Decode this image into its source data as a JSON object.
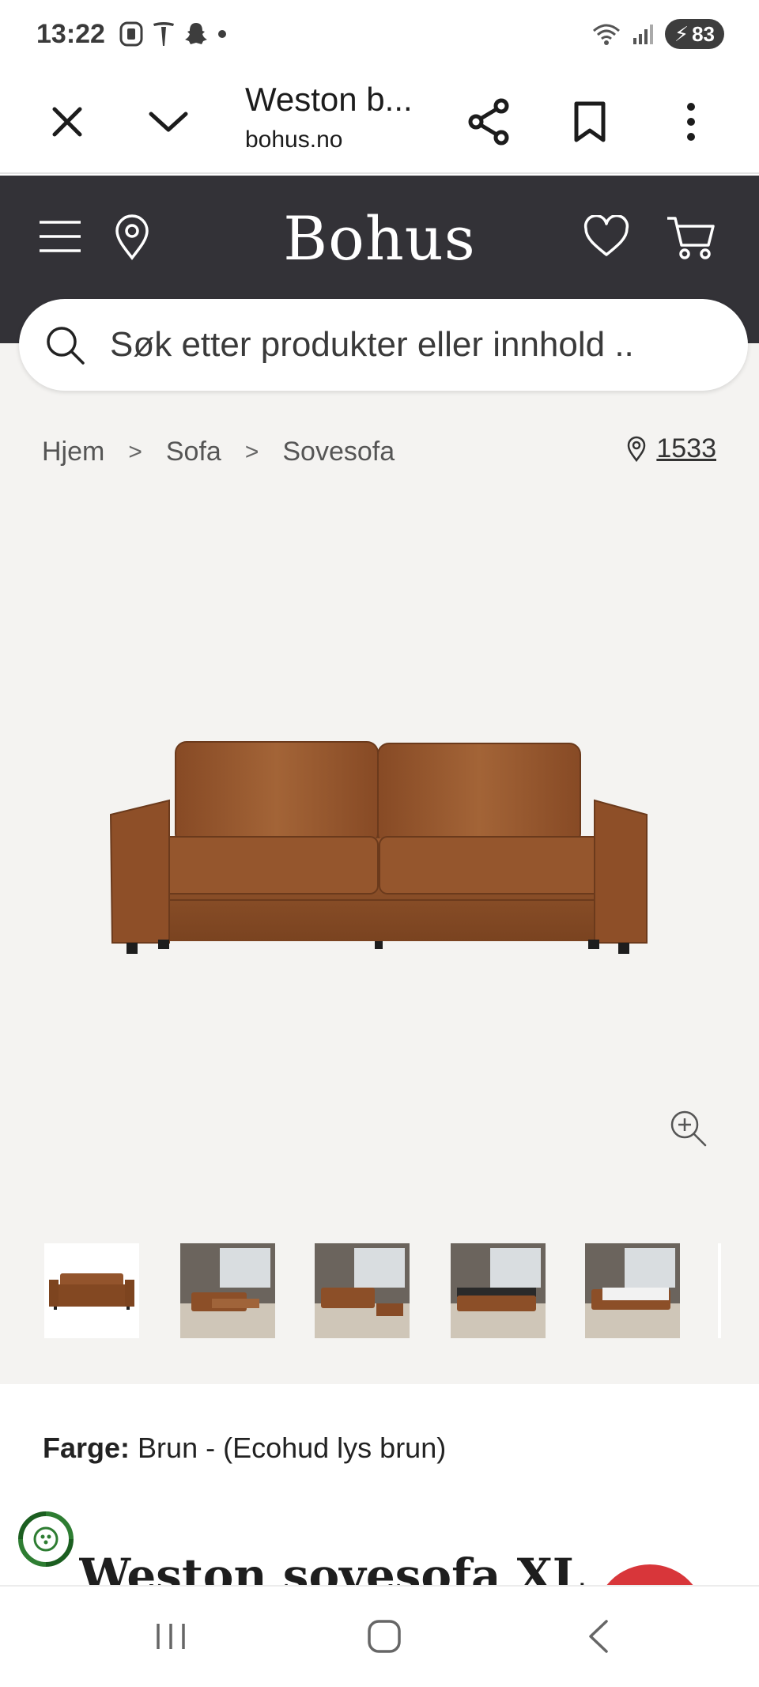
{
  "status_bar": {
    "time": "13:22",
    "battery": "83"
  },
  "browser": {
    "title": "Weston b...",
    "domain": "bohus.no"
  },
  "site": {
    "logo": "Bohus",
    "search_placeholder": "Søk etter produkter eller innhold .."
  },
  "breadcrumb": {
    "items": [
      "Hjem",
      "Sofa",
      "Sovesofa"
    ]
  },
  "store": {
    "number": "1533"
  },
  "product": {
    "color_label": "Farge:",
    "color_value": "Brun - (Ecohud lys brun)",
    "title": "Weston sovesofa XL"
  },
  "colors": {
    "header_bg": "#333237",
    "product_bg": "#f4f3f1",
    "accent_red": "#d8363a",
    "sofa_brown": "#8a4f2a"
  },
  "thumbnails": [
    {
      "name": "sofa-front"
    },
    {
      "name": "sofa-room-bed-open"
    },
    {
      "name": "sofa-room-ottoman"
    },
    {
      "name": "sofa-room-storage-open"
    },
    {
      "name": "sofa-room-bed-made"
    }
  ]
}
